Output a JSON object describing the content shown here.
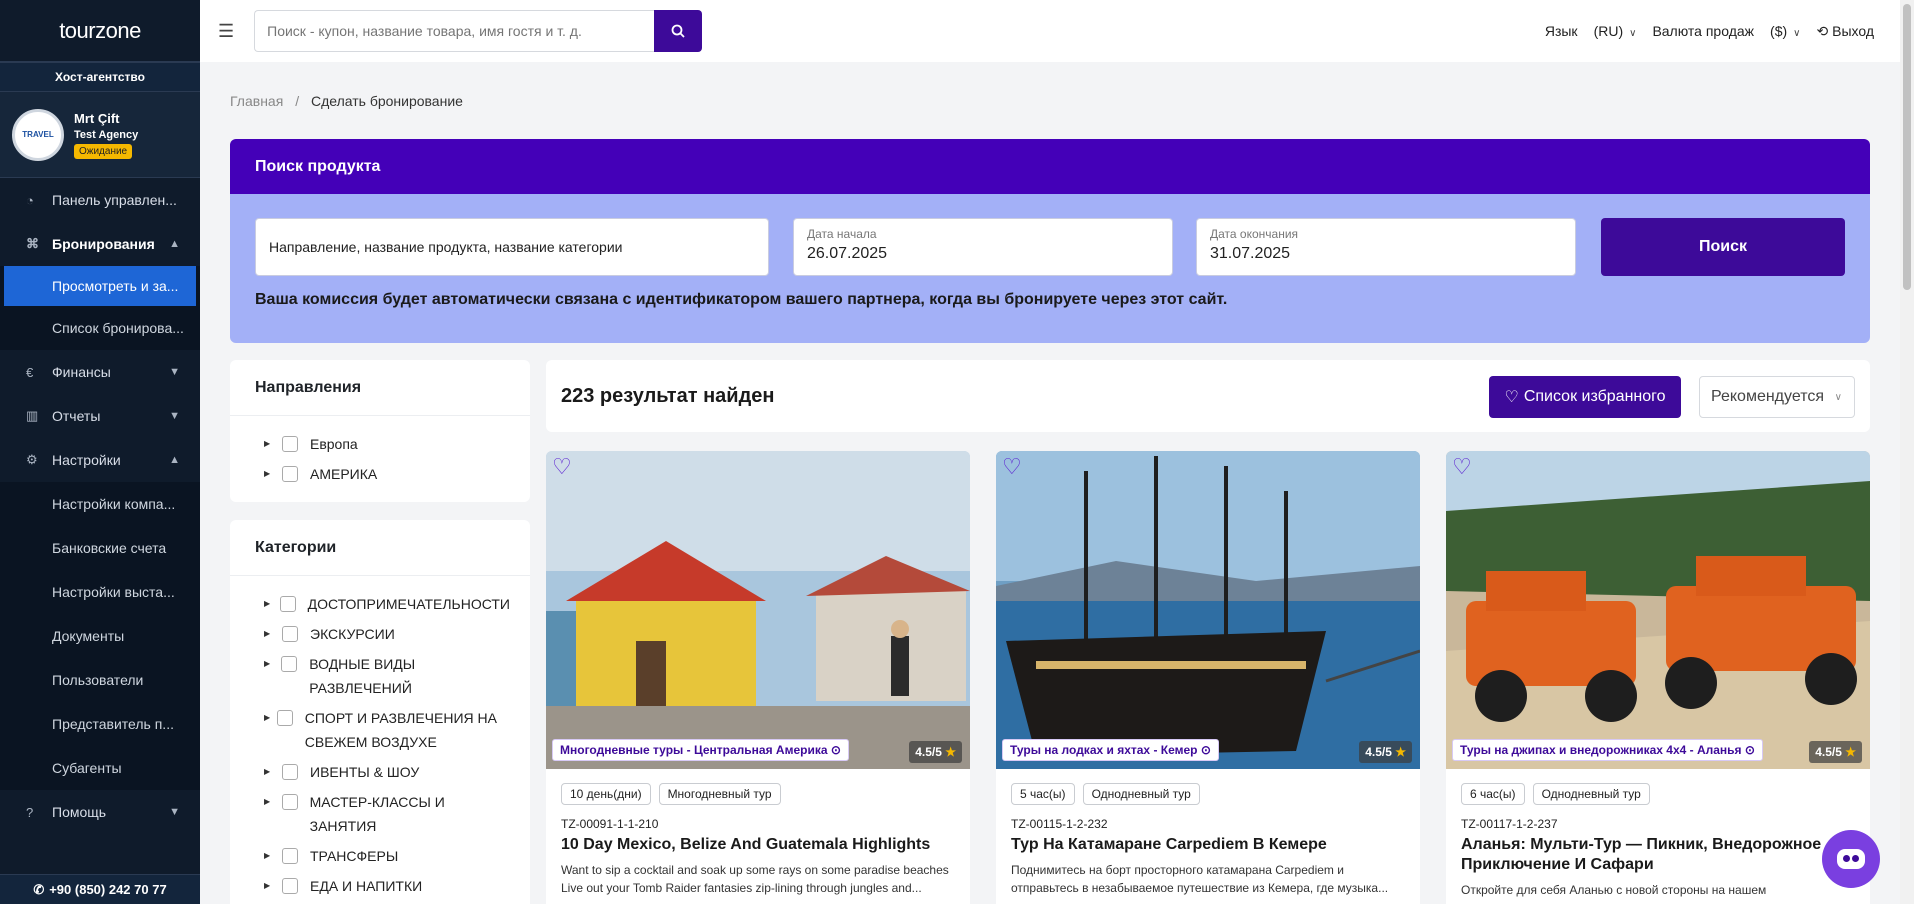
{
  "brand": {
    "logo": "tourzone",
    "host_label": "Хост-агентство"
  },
  "user": {
    "name": "Mrt Çift",
    "agency": "Test Agency",
    "status": "Ожидание",
    "avatar_text": "TRAVEL"
  },
  "sidebar": {
    "items": [
      {
        "label": "Панель управлен...",
        "icon": "dashboard-icon"
      },
      {
        "label": "Бронирования",
        "icon": "tag-icon"
      },
      {
        "label": "Финансы",
        "icon": "finance-icon"
      },
      {
        "label": "Отчеты",
        "icon": "chart-icon"
      },
      {
        "label": "Настройки",
        "icon": "gear-icon"
      },
      {
        "label": "Помощь",
        "icon": "help-icon"
      }
    ],
    "booking_sub": [
      "Просмотреть и за...",
      "Список бронирова..."
    ],
    "settings_sub": [
      "Настройки компа...",
      "Банковские счета",
      "Настройки выста...",
      "Документы",
      "Пользователи",
      "Представитель п...",
      "Субагенты"
    ],
    "phone": "+90 (850) 242 70 77"
  },
  "topbar": {
    "search_placeholder": "Поиск - купон, название товара, имя гостя и т. д.",
    "language_label": "Язык",
    "language_value": "(RU)",
    "currency_label": "Валюта продаж",
    "currency_value": "($)",
    "logout": "Выход"
  },
  "breadcrumb": {
    "home": "Главная",
    "current": "Сделать бронирование"
  },
  "product_search": {
    "title": "Поиск продукта",
    "destination_placeholder": "Направление, название продукта, название категории",
    "start_label": "Дата начала",
    "start_value": "26.07.2025",
    "end_label": "Дата окончания",
    "end_value": "31.07.2025",
    "search_button": "Поиск",
    "commission_note": "Ваша комиссия будет автоматически связана с идентификатором вашего партнера, когда вы бронируете через этот сайт."
  },
  "filters": {
    "destinations_title": "Направления",
    "destinations": [
      "Европа",
      "АМЕРИКА"
    ],
    "categories_title": "Категории",
    "categories": [
      "ДОСТОПРИМЕЧАТЕЛЬНОСТИ",
      "ЭКСКУРСИИ",
      "ВОДНЫЕ ВИДЫ РАЗВЛЕЧЕНИЙ",
      "СПОРТ И РАЗВЛЕЧЕНИЯ НА СВЕЖЕМ ВОЗДУХЕ",
      "ИВЕНТЫ & ШОУ",
      "МАСТЕР-КЛАССЫ И ЗАНЯТИЯ",
      "ТРАНСФЕРЫ",
      "ЕДА И НАПИТКИ"
    ]
  },
  "results": {
    "count": "223 результат найден",
    "favorites_button": "Список избранного",
    "sort_value": "Рекомендуется",
    "cards": [
      {
        "category": "Многодневные туры - Центральная Америка",
        "rating": "4.5/5",
        "duration": "10 день(дни)",
        "type": "Многодневный тур",
        "code": "TZ-00091-1-1-210",
        "title": "10 Day Mexico, Belize And Guatemala Highlights",
        "desc": "Want to sip a cocktail and soak up some rays on some paradise beaches Live out your Tomb Raider fantasies zip-lining through jungles and..."
      },
      {
        "category": "Туры на лодках и яхтах - Кемер",
        "rating": "4.5/5",
        "duration": "5 час(ы)",
        "type": "Однодневный тур",
        "code": "TZ-00115-1-2-232",
        "title": "Тур На Катамаране Carpediem В Кемере",
        "desc": "Поднимитесь на борт просторного катамарана Carpediem и отправьтесь в незабываемое путешествие из Кемера, где музыка..."
      },
      {
        "category": "Туры на джипах и внедорожниках 4х4 - Аланья",
        "rating": "4.5/5",
        "duration": "6 час(ы)",
        "type": "Однодневный тур",
        "code": "TZ-00117-1-2-237",
        "title": "Аланья: Мульти-Тур — Пикник, Внедорожное Приключение И Сафари",
        "desc": "Откройте для себя Аланью с новой стороны на нашем"
      }
    ]
  },
  "colors": {
    "brand_purple": "#3d0a99",
    "header_purple": "#4400b8",
    "panel_bg": "#a3b0f7",
    "sidebar_bg": "#0f1b2b",
    "active_nav": "#1e66d6"
  }
}
